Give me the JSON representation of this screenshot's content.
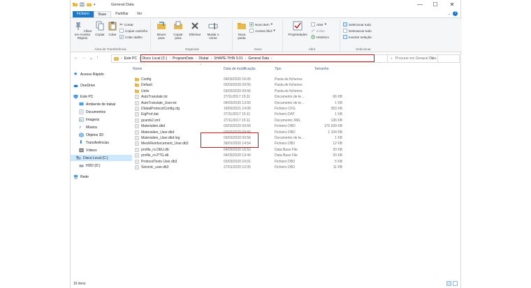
{
  "window": {
    "title": "General Data"
  },
  "window_controls": {
    "minimize": "—",
    "maximize": "☐",
    "close": "✕"
  },
  "tabs": [
    {
      "label": "Ficheiro"
    },
    {
      "label": "Base"
    },
    {
      "label": "Partilhar"
    },
    {
      "label": "Ver"
    }
  ],
  "ribbon": {
    "clipboard": {
      "pin": "Afixar em Acesso Rápido",
      "copy": "Copiar",
      "paste": "Colar",
      "cut": "Cortar",
      "copy_path": "Copiar caminho",
      "paste_shortcut": "Colar atalho",
      "group": "Área de Transferência"
    },
    "organize": {
      "move": "Mover para",
      "copy_to": "Copiar para",
      "delete": "Eliminar",
      "rename": "Mudar o nome",
      "group": "Organizar"
    },
    "new": {
      "folder": "Nova pasta",
      "new_item": "Novo item",
      "easy_access": "Acesso fácil",
      "group": "Novo"
    },
    "open": {
      "properties": "Propriedades",
      "open": "Abrir",
      "edit": "Editar",
      "history": "Histórico",
      "group": "Abrir"
    },
    "select": {
      "select_all": "Selecionar tudo",
      "select_none": "Desmarcar tudo",
      "invert": "Inverter seleção",
      "group": "Selecionar"
    }
  },
  "address": {
    "segments": [
      "Este PC",
      "Disco Local (C:)",
      "ProgramData",
      "Dlubal",
      "SHAPE-THIN 9.01",
      "General Data"
    ],
    "search_placeholder": "Procurar em General Data"
  },
  "nav": [
    {
      "label": "Acesso Rápido",
      "icon": "star-icon"
    },
    {
      "label": "OneDrive",
      "icon": "cloud-icon"
    },
    {
      "label": "Este PC",
      "icon": "pc-icon"
    },
    {
      "label": "Ambiente de trabal",
      "icon": "desktop-icon"
    },
    {
      "label": "Documentos",
      "icon": "documents-icon"
    },
    {
      "label": "Imagens",
      "icon": "images-icon"
    },
    {
      "label": "Música",
      "icon": "music-icon"
    },
    {
      "label": "Objetos 3D",
      "icon": "cube-icon"
    },
    {
      "label": "Transferências",
      "icon": "download-icon"
    },
    {
      "label": "Vídeos",
      "icon": "video-icon"
    },
    {
      "label": "Disco Local (C:)",
      "icon": "drive-icon"
    },
    {
      "label": "HDD (D:)",
      "icon": "drive-icon"
    },
    {
      "label": "Rede",
      "icon": "network-icon"
    }
  ],
  "columns": {
    "name": "Nome",
    "date": "Data de modificação",
    "type": "Tipo",
    "size": "Tamanho"
  },
  "files": [
    {
      "name": "Config",
      "date": "04/03/2020 16:05",
      "type": "Pasta de ficheiros",
      "size": "",
      "kind": "folder"
    },
    {
      "name": "Default",
      "date": "03/03/2020 09:55",
      "type": "Pasta de ficheiros",
      "size": "",
      "kind": "folder"
    },
    {
      "name": "Units",
      "date": "03/03/2020 09:56",
      "type": "Pasta de ficheiros",
      "size": "",
      "kind": "folder"
    },
    {
      "name": "AutoTranslate.txt",
      "date": "27/11/2017 15:11",
      "type": "Documento de te...",
      "size": "66 KB",
      "kind": "file"
    },
    {
      "name": "AutoTranslate_User.txt",
      "date": "04/03/2020 13:55",
      "type": "Documento de te...",
      "size": "1 KB",
      "kind": "file"
    },
    {
      "name": "DlubalProtocolConfig.cfg",
      "date": "19/03/2021 14:05",
      "type": "Ficheiro CFG",
      "size": "353 KB",
      "kind": "file"
    },
    {
      "name": "EigProf.dat",
      "date": "27/11/2017 15:11",
      "type": "Ficheiro DAT",
      "size": "1 KB",
      "kind": "file"
    },
    {
      "name": "gcards2.xml",
      "date": "27/11/2017 15:11",
      "type": "Documento XML",
      "size": "136 KB",
      "kind": "file"
    },
    {
      "name": "Materialien.dbd",
      "date": "03/03/2020 09:56",
      "type": "Ficheiro DBD",
      "size": "176 539 KB",
      "kind": "file"
    },
    {
      "name": "Materialien_User.dbd",
      "date": "03/03/2020 09:56",
      "type": "Ficheiro DBD",
      "size": "1 104 KB",
      "kind": "file"
    },
    {
      "name": "Materialien_User.dbd.log",
      "date": "03/03/2020 09:56",
      "type": "Documento de te...",
      "size": "1 KB",
      "kind": "file"
    },
    {
      "name": "MeshReinforcement_User.db3",
      "date": "28/01/2020 14:54",
      "type": "Ficheiro DB3",
      "size": "12 KB",
      "kind": "file"
    },
    {
      "name": "profile_ro.DEU.db",
      "date": "04/03/2020 16:52",
      "type": "Data Base File",
      "size": "20 KB",
      "kind": "file"
    },
    {
      "name": "profile_ro.PTG.db",
      "date": "04/03/2020 13:44",
      "type": "Data Base File",
      "size": "20 KB",
      "kind": "file"
    },
    {
      "name": "ProtocolTexts User.db3",
      "date": "03/03/2020 10:01",
      "type": "Ficheiro DB3",
      "size": "5 KB",
      "kind": "file"
    },
    {
      "name": "Seismic_user.db3",
      "date": "27/01/2020 12:05",
      "type": "Ficheiro DB3",
      "size": "11 KB",
      "kind": "file"
    }
  ],
  "status": {
    "count": "16 itens"
  },
  "colors": {
    "accent": "#1979ca",
    "folder": "#e8b84a",
    "highlight": "#c0161b",
    "selection": "#cce8ff"
  }
}
